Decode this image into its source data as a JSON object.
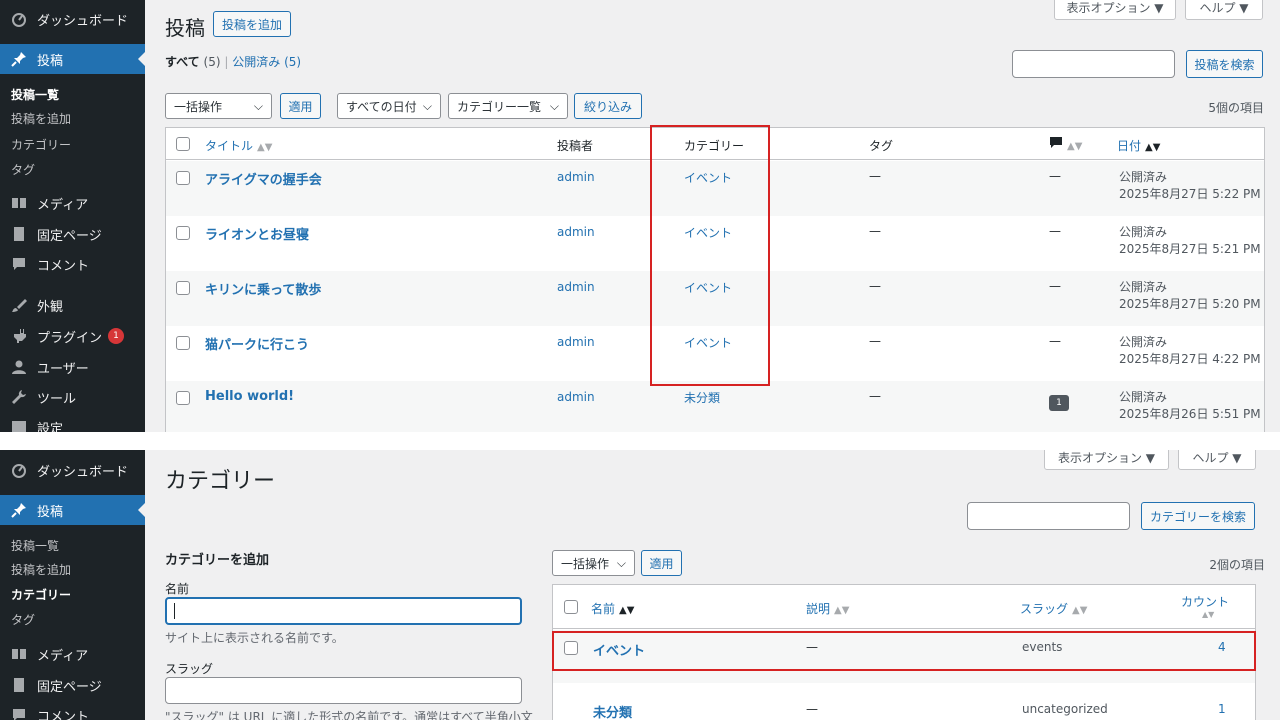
{
  "sidebar": {
    "dashboard": "ダッシュボード",
    "posts": "投稿",
    "post_list": "投稿一覧",
    "add_post": "投稿を追加",
    "categories": "カテゴリー",
    "tags": "タグ",
    "media": "メディア",
    "pages": "固定ページ",
    "comments": "コメント",
    "appearance": "外観",
    "plugins": "プラグイン",
    "plugins_badge": "1",
    "users": "ユーザー",
    "tools": "ツール",
    "settings": "設定"
  },
  "posts_screen": {
    "title": "投稿",
    "add_button": "投稿を追加",
    "screen_options": "表示オプション ▼",
    "help": "ヘルプ ▼",
    "filter_all": "すべて",
    "filter_all_count": "(5)",
    "filter_sep": "|",
    "filter_published": "公開済み",
    "filter_published_count": "(5)",
    "search_button": "投稿を検索",
    "bulk_action": "一括操作",
    "apply": "適用",
    "all_dates": "すべての日付",
    "category_filter": "カテゴリー一覧",
    "filter_button": "絞り込み",
    "item_count": "5個の項目",
    "columns": {
      "title": "タイトル",
      "author": "投稿者",
      "category": "カテゴリー",
      "tags": "タグ",
      "date": "日付"
    },
    "rows": [
      {
        "title": "アライグマの握手会",
        "author": "admin",
        "category": "イベント",
        "tags": "—",
        "comments": "—",
        "status": "公開済み",
        "date": "2025年8月27日 5:22 PM"
      },
      {
        "title": "ライオンとお昼寝",
        "author": "admin",
        "category": "イベント",
        "tags": "—",
        "comments": "—",
        "status": "公開済み",
        "date": "2025年8月27日 5:21 PM"
      },
      {
        "title": "キリンに乗って散歩",
        "author": "admin",
        "category": "イベント",
        "tags": "—",
        "comments": "—",
        "status": "公開済み",
        "date": "2025年8月27日 5:20 PM"
      },
      {
        "title": "猫パークに行こう",
        "author": "admin",
        "category": "イベント",
        "tags": "—",
        "comments": "—",
        "status": "公開済み",
        "date": "2025年8月27日 4:22 PM"
      },
      {
        "title": "Hello world!",
        "author": "admin",
        "category": "未分類",
        "tags": "—",
        "comments": "1",
        "status": "公開済み",
        "date": "2025年8月26日 5:51 PM"
      }
    ]
  },
  "category_screen": {
    "title": "カテゴリー",
    "screen_options": "表示オプション ▼",
    "help": "ヘルプ ▼",
    "search_button": "カテゴリーを検索",
    "add_heading": "カテゴリーを追加",
    "name_label": "名前",
    "name_help": "サイト上に表示される名前です。",
    "slug_label": "スラッグ",
    "slug_help": "\"スラッグ\" は URL に適した形式の名前です。通常はすべて半角小文",
    "bulk_action": "一括操作",
    "apply": "適用",
    "item_count": "2個の項目",
    "columns": {
      "name": "名前",
      "description": "説明",
      "slug": "スラッグ",
      "count": "カウント"
    },
    "rows": [
      {
        "name": "イベント",
        "description": "—",
        "slug": "events",
        "count": "4"
      },
      {
        "name": "未分類",
        "description": "—",
        "slug": "uncategorized",
        "count": "1"
      }
    ]
  }
}
